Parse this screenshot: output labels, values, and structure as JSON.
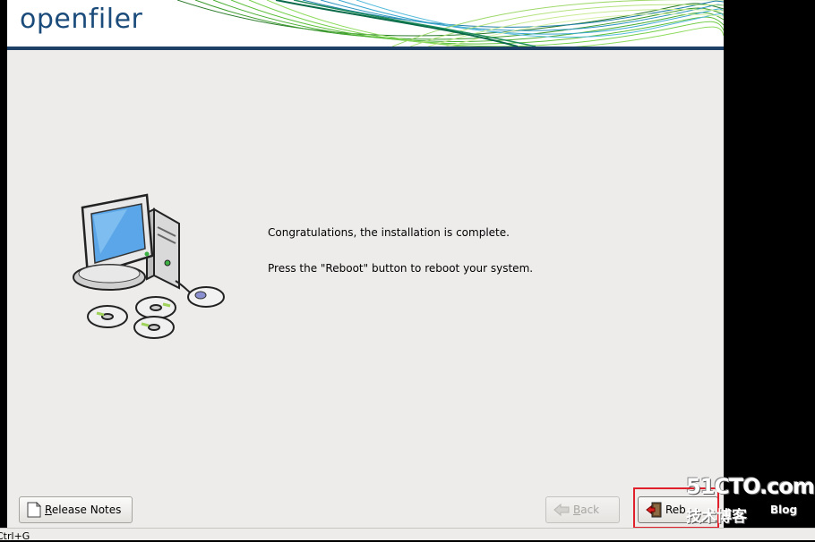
{
  "app": {
    "logo": "openfiler"
  },
  "main": {
    "message_complete": "Congratulations, the installation is complete.",
    "message_reboot": "Press the \"Reboot\" button to reboot your system."
  },
  "buttons": {
    "release_notes": {
      "mnemonic": "R",
      "rest": "elease Notes"
    },
    "back": {
      "mnemonic": "B",
      "rest": "ack"
    },
    "reboot": {
      "visible_text": "Reb"
    }
  },
  "status_bar": {
    "text": "Ctrl+G"
  },
  "watermark": {
    "site": "51CTO.com",
    "chinese": "技术博客",
    "blog": "Blog"
  },
  "icons": {
    "illustration": "computer-with-discs-illustration",
    "release_notes": "document-icon",
    "back": "left-arrow-icon",
    "reboot": "exit-door-icon"
  },
  "colors": {
    "header_rule": "#1e3f66",
    "logo": "#1a4b7a",
    "panel_bg": "#edeceb",
    "highlight": "#e0202a"
  }
}
